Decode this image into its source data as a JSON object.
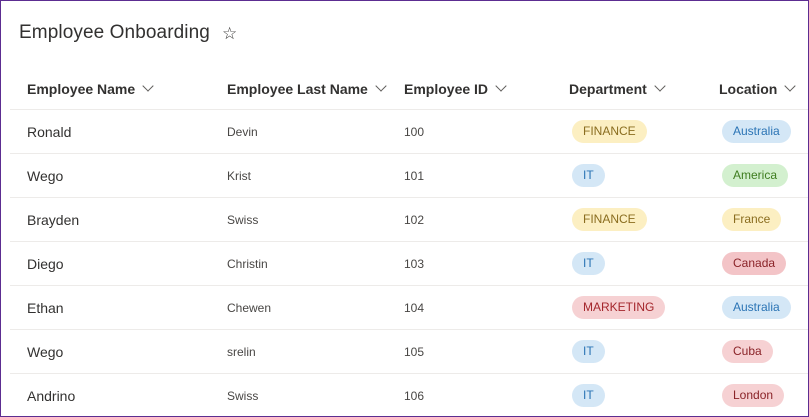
{
  "title": "Employee Onboarding",
  "favorite_icon": "star-outline-icon",
  "columns": [
    {
      "label": "Employee Name"
    },
    {
      "label": "Employee Last Name"
    },
    {
      "label": "Employee ID"
    },
    {
      "label": "Department"
    },
    {
      "label": "Location"
    }
  ],
  "pill_colors": {
    "FINANCE": {
      "bg": "#fcefc2",
      "fg": "#8a6d1f"
    },
    "IT": {
      "bg": "#d4e7f6",
      "fg": "#2b74b5"
    },
    "MARKETING": {
      "bg": "#f6d1d3",
      "fg": "#a4262c"
    },
    "Australia": {
      "bg": "#d4e7f6",
      "fg": "#2b74b5"
    },
    "America": {
      "bg": "#d3f0cf",
      "fg": "#3f7d20"
    },
    "France": {
      "bg": "#fcefc2",
      "fg": "#8a6d1f"
    },
    "Canada": {
      "bg": "#f3c4c7",
      "fg": "#8a2328"
    },
    "Cuba": {
      "bg": "#f6d1d3",
      "fg": "#8a2328"
    },
    "London": {
      "bg": "#f6d1d3",
      "fg": "#8a2328"
    }
  },
  "rows": [
    {
      "first": "Ronald",
      "last": "Devin",
      "id": "100",
      "dept": "FINANCE",
      "location": "Australia"
    },
    {
      "first": "Wego",
      "last": "Krist",
      "id": "101",
      "dept": "IT",
      "location": "America"
    },
    {
      "first": "Brayden",
      "last": "Swiss",
      "id": "102",
      "dept": "FINANCE",
      "location": "France"
    },
    {
      "first": "Diego",
      "last": "Christin",
      "id": "103",
      "dept": "IT",
      "location": "Canada"
    },
    {
      "first": "Ethan",
      "last": "Chewen",
      "id": "104",
      "dept": "MARKETING",
      "location": "Australia"
    },
    {
      "first": "Wego",
      "last": "srelin",
      "id": "105",
      "dept": "IT",
      "location": "Cuba"
    },
    {
      "first": "Andrino",
      "last": "Swiss",
      "id": "106",
      "dept": "IT",
      "location": "London"
    }
  ]
}
